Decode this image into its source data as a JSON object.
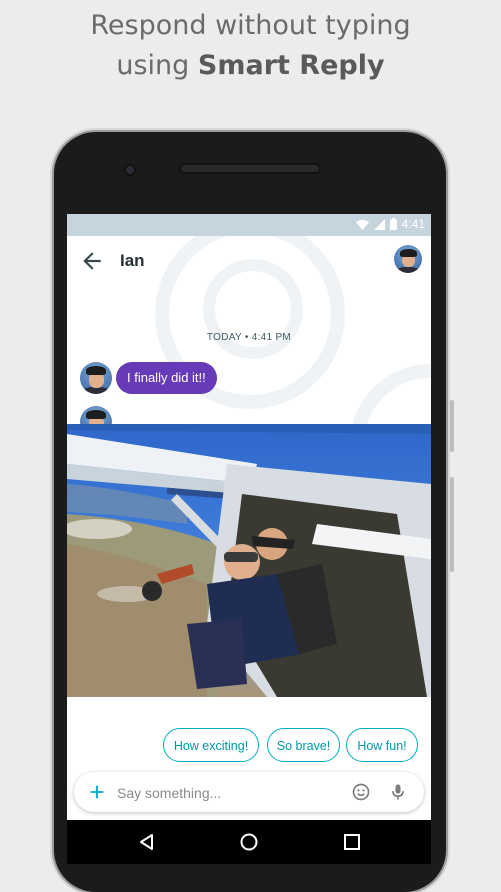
{
  "headline": {
    "line1": "Respond without typing",
    "line2_prefix": "using ",
    "line2_bold": "Smart Reply"
  },
  "statusbar": {
    "time": "4:41",
    "icons": [
      "wifi-icon",
      "cell-signal-icon",
      "battery-icon"
    ]
  },
  "conversation": {
    "contact_name": "Ian",
    "timestamp": "TODAY • 4:41 PM",
    "message_text": "I finally did it!!"
  },
  "smart_replies": [
    "How exciting!",
    "So brave!",
    "How fun!"
  ],
  "compose": {
    "placeholder": "Say something..."
  },
  "colors": {
    "accent_teal": "#00acc1",
    "bubble_purple": "#673ab7",
    "statusbar": "#c6d4de"
  }
}
